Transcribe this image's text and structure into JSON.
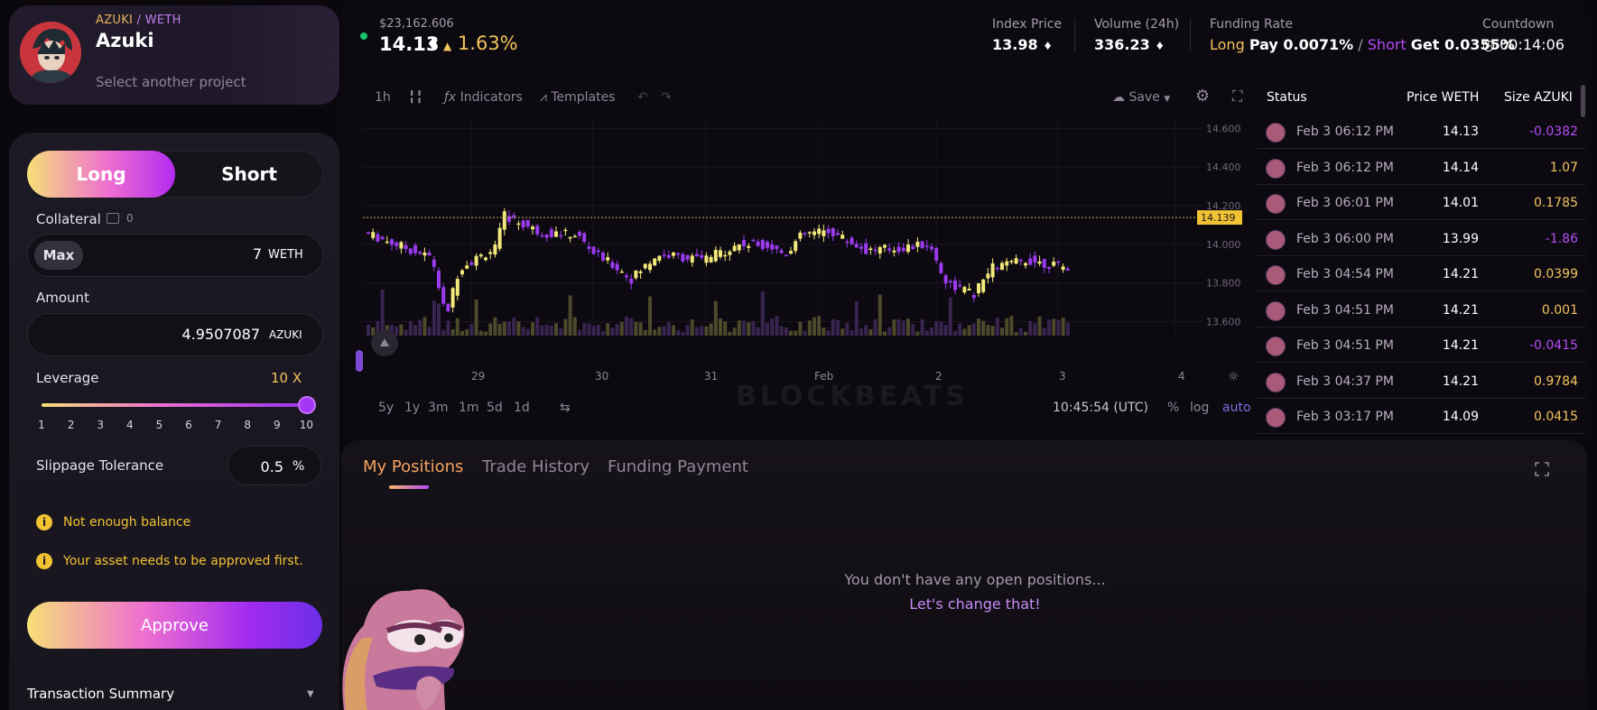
{
  "project": {
    "pair_base": "AZUKI",
    "pair_sep": " / ",
    "pair_quote": "WETH",
    "name": "Azuki",
    "select_text": "Select another project"
  },
  "trade_form": {
    "long_label": "Long",
    "short_label": "Short",
    "collateral_label": "Collateral",
    "collateral_balance": "0",
    "max_label": "Max",
    "collateral_value": "7",
    "collateral_unit": "WETH",
    "amount_label": "Amount",
    "amount_value": "4.9507087",
    "amount_unit": "AZUKI",
    "leverage_label": "Leverage",
    "leverage_value": "10 X",
    "leverage_level": 10,
    "leverage_ticks": [
      "1",
      "2",
      "3",
      "4",
      "5",
      "6",
      "7",
      "8",
      "9",
      "10"
    ],
    "slippage_label": "Slippage Tolerance",
    "slippage_value": "0.5",
    "slippage_unit": "%",
    "warnings": [
      "Not enough balance",
      "Your asset needs to be approved first."
    ],
    "approve_label": "Approve",
    "summary_label": "Transaction Summary"
  },
  "header": {
    "market_cap": "$23,162.606",
    "price": "14.13",
    "change": "1.63%",
    "index_label": "Index Price",
    "index_value": "13.98",
    "volume_label": "Volume (24h)",
    "volume_value": "336.23",
    "funding_label": "Funding Rate",
    "funding_long": "Long",
    "funding_long_pay": "Pay 0.0071%",
    "funding_slash": "/",
    "funding_short": "Short",
    "funding_short_get": "Get 0.0355%",
    "countdown_label": "Countdown",
    "countdown_value": "00:14:06"
  },
  "chart_toolbar": {
    "interval": "1h",
    "indicators": "Indicators",
    "templates": "Templates",
    "save": "Save",
    "ranges": [
      "5y",
      "1y",
      "3m",
      "1m",
      "5d",
      "1d"
    ],
    "time": "10:45:54 (UTC)",
    "pct": "%",
    "log": "log",
    "auto": "auto",
    "x_labels": [
      "29",
      "30",
      "31",
      "Feb",
      "2",
      "3",
      "4"
    ],
    "y_labels": [
      "14.600",
      "14.400",
      "14.200",
      "14.000",
      "13.800",
      "13.600"
    ],
    "last_price_tag": "14.139"
  },
  "chart_data": {
    "type": "candlestick",
    "ylim": [
      13.5,
      14.62
    ],
    "x_ticks": [
      "29",
      "30",
      "31",
      "Feb",
      "2",
      "3",
      "4"
    ],
    "last_price": 14.139
  },
  "trades": {
    "headers": {
      "status": "Status",
      "price": "Price WETH",
      "size": "Size AZUKI"
    },
    "rows": [
      {
        "time": "Feb 3 06:12 PM",
        "price": "14.13",
        "size": "-0.0382"
      },
      {
        "time": "Feb 3 06:12 PM",
        "price": "14.14",
        "size": "1.07"
      },
      {
        "time": "Feb 3 06:01 PM",
        "price": "14.01",
        "size": "0.1785"
      },
      {
        "time": "Feb 3 06:00 PM",
        "price": "13.99",
        "size": "-1.86"
      },
      {
        "time": "Feb 3 04:54 PM",
        "price": "14.21",
        "size": "0.0399"
      },
      {
        "time": "Feb 3 04:51 PM",
        "price": "14.21",
        "size": "0.001"
      },
      {
        "time": "Feb 3 04:51 PM",
        "price": "14.21",
        "size": "-0.0415"
      },
      {
        "time": "Feb 3 04:37 PM",
        "price": "14.21",
        "size": "0.9784"
      },
      {
        "time": "Feb 3 03:17 PM",
        "price": "14.09",
        "size": "0.0415"
      }
    ]
  },
  "positions": {
    "tabs": [
      "My Positions",
      "Trade History",
      "Funding Payment"
    ],
    "empty_message": "You don't have any open positions...",
    "empty_cta": "Let's change that!"
  },
  "watermark": "BLOCKBEATS",
  "colors": {
    "accent_yellow": "#f3c55d",
    "accent_purple": "#b24df5",
    "up_candle": "#f3e97a",
    "down_candle": "#9b3bf0"
  }
}
